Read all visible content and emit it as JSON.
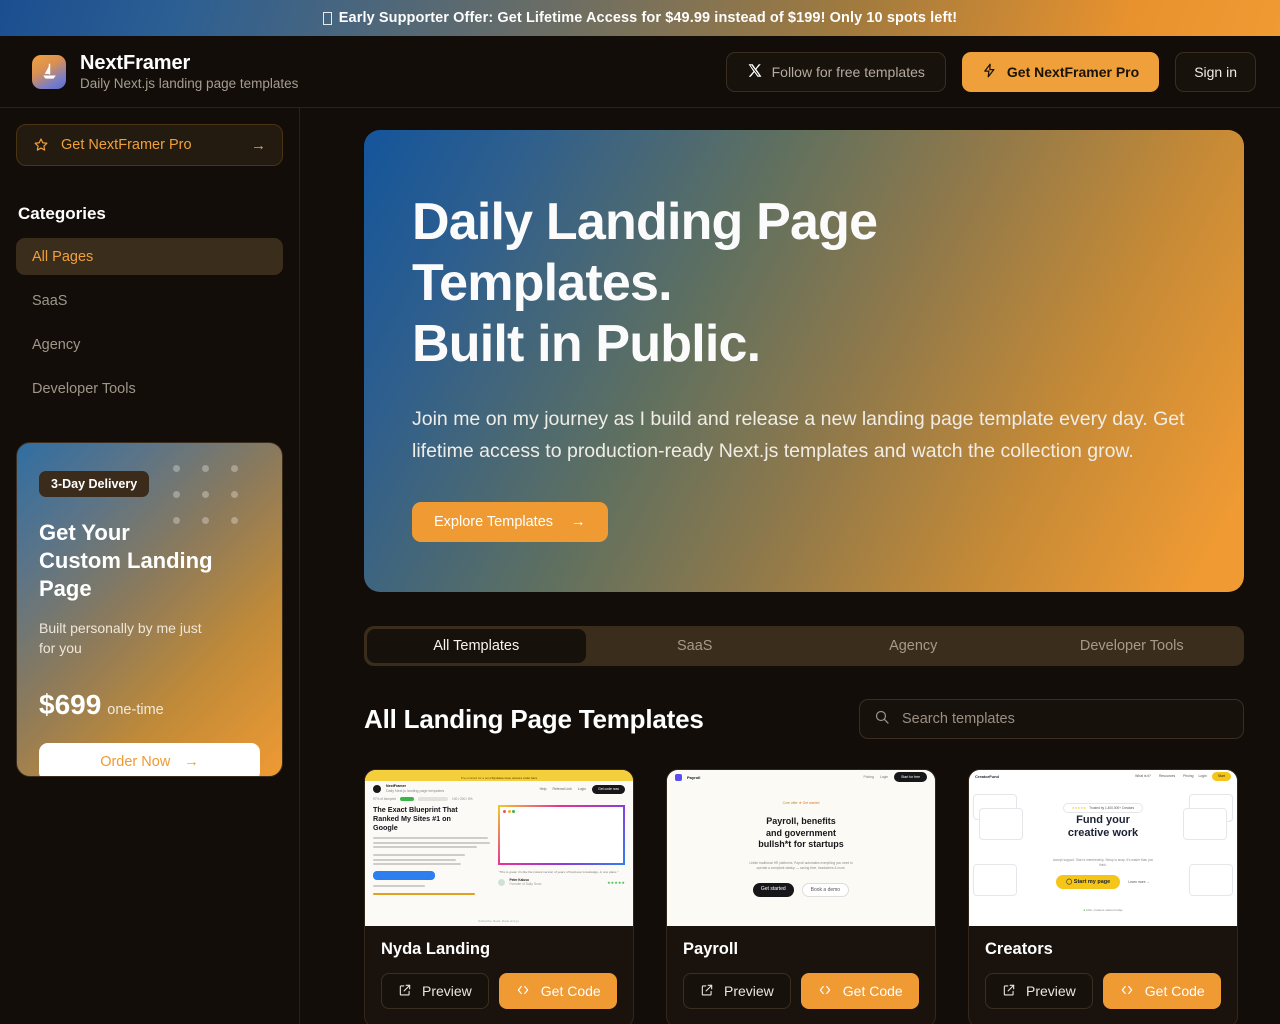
{
  "banner": {
    "text": "Early Supporter Offer: Get Lifetime Access for $49.99 instead of $199! Only 10 spots left!",
    "icon": "missing-glyph-box"
  },
  "header": {
    "logo_icon": "sailboat-icon",
    "brand_title": "NextFramer",
    "brand_subtitle": "Daily Next.js landing page templates",
    "follow_label": "Follow for free templates",
    "follow_icon": "x-twitter-icon",
    "pro_label": "Get NextFramer Pro",
    "pro_icon": "lightning-bolt-icon",
    "signin_label": "Sign in"
  },
  "sidebar": {
    "pro_cta": {
      "label": "Get NextFramer Pro",
      "icon": "star-icon",
      "arrow": "→"
    },
    "categories_title": "Categories",
    "items": [
      {
        "label": "All Pages",
        "active": true
      },
      {
        "label": "SaaS",
        "active": false
      },
      {
        "label": "Agency",
        "active": false
      },
      {
        "label": "Developer Tools",
        "active": false
      }
    ],
    "promo": {
      "badge": "3-Day Delivery",
      "heading": "Get Your Custom Landing Page",
      "description": "Built personally by me just for you",
      "price": "$699",
      "price_note": "one-time",
      "button_label": "Order Now",
      "button_arrow": "→"
    }
  },
  "hero": {
    "title_line1": "Daily Landing Page",
    "title_line2": "Templates.",
    "title_line3": "Built in Public.",
    "description": "Join me on my journey as I build and release a new landing page template every day. Get lifetime access to production-ready Next.js templates and watch the collection grow.",
    "cta_label": "Explore Templates",
    "cta_arrow": "→"
  },
  "tabs": [
    {
      "label": "All Templates",
      "active": true
    },
    {
      "label": "SaaS",
      "active": false
    },
    {
      "label": "Agency",
      "active": false
    },
    {
      "label": "Developer Tools",
      "active": false
    }
  ],
  "section": {
    "title": "All Landing Page Templates",
    "search_placeholder": "Search templates",
    "search_value": "",
    "search_icon": "search-icon"
  },
  "cards": [
    {
      "title": "Nyda Landing",
      "preview_label": "Preview",
      "preview_icon": "external-link-icon",
      "code_label": "Get Code",
      "code_icon": "code-brackets-icon",
      "thumb": {
        "headline": "The Exact Blueprint That Ranked My Sites #1 on Google",
        "cta": "Try it out now for $99 $199"
      }
    },
    {
      "title": "Payroll",
      "preview_label": "Preview",
      "preview_icon": "external-link-icon",
      "code_label": "Get Code",
      "code_icon": "code-brackets-icon",
      "thumb": {
        "brand": "Payroll",
        "headline": "Payroll, benefits and government bullsh*t for startups",
        "cta": "Get started",
        "cta2": "Book a demo"
      }
    },
    {
      "title": "Creators",
      "preview_label": "Preview",
      "preview_icon": "external-link-icon",
      "code_label": "Get Code",
      "code_icon": "code-brackets-icon",
      "thumb": {
        "brand": "CreatorFund",
        "headline": "Fund your creative work",
        "cta": "Start my page",
        "cta2": "Learn more"
      }
    }
  ],
  "colors": {
    "accent": "#ef9a33",
    "accent_soft": "#f0a03a",
    "background": "#120d09",
    "surface": "#1a130d",
    "border": "#32261a",
    "text": "#ffffff",
    "muted": "#9f9589"
  }
}
